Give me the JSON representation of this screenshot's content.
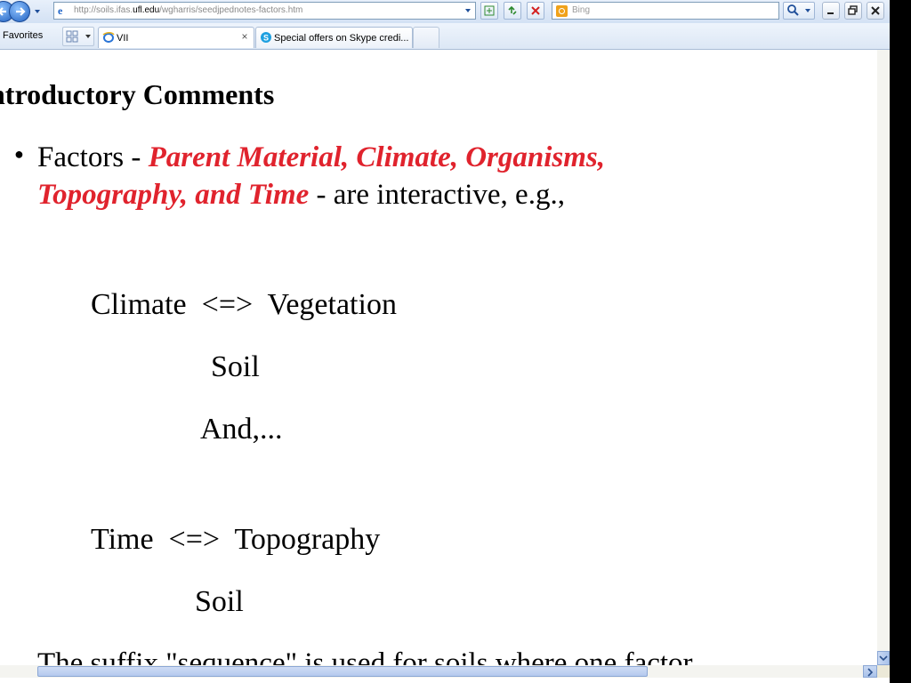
{
  "browser": {
    "address": {
      "url_prefix": "http://soils.ifas.",
      "url_domain": "ufl.edu",
      "url_suffix": "/wgharris/seedjpednotes-factors.htm"
    },
    "search": {
      "placeholder": "Bing"
    },
    "favorites_label": "Favorites",
    "tabs": [
      {
        "label": "VII",
        "active": true
      },
      {
        "label": "Special offers on Skype credi...",
        "active": false
      }
    ]
  },
  "page": {
    "heading": "ntroductory Comments",
    "bullet": {
      "prefix": "Factors - ",
      "highlighted": "Parent Material, Climate, Organisms, Topography, and Time",
      "suffix": " - are interactive, e.g.,"
    },
    "diagram_lines": [
      "Climate  <=>  Vegetation",
      "Soil",
      "And,...",
      "Time  <=>  Topography",
      "Soil"
    ],
    "cut_line": "The suffix \"sequence\" is used for soils where one factor"
  },
  "colors": {
    "highlight": "#e0232d",
    "chrome": "#dce7f5"
  }
}
